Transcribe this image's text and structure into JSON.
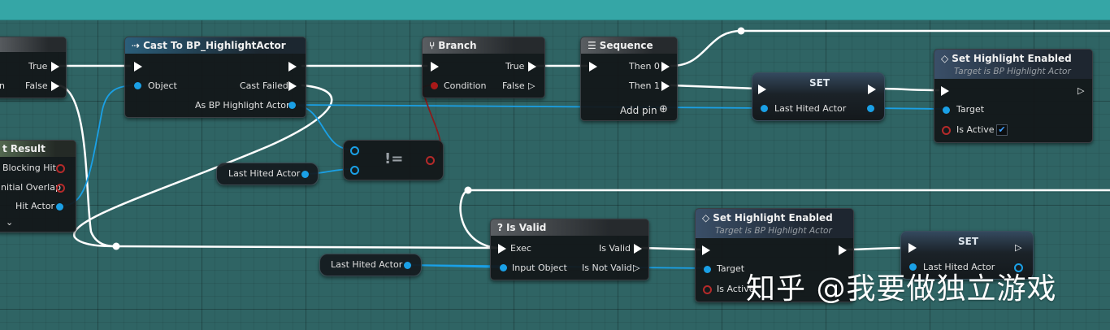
{
  "nodes": {
    "branch_left": {
      "true_label": "True",
      "partial_label": "n",
      "false_label": "False"
    },
    "hit_result": {
      "title": "t Result",
      "pins": [
        "Blocking Hit",
        "nitial Overlap",
        "Hit Actor"
      ]
    },
    "cast": {
      "title": "Cast To BP_HighlightActor",
      "object": "Object",
      "cast_failed": "Cast Failed",
      "as_actor": "As BP Highlight Actor"
    },
    "branch": {
      "title": "Branch",
      "condition": "Condition",
      "true_label": "True",
      "false_label": "False"
    },
    "sequence": {
      "title": "Sequence",
      "then0": "Then 0",
      "then1": "Then 1",
      "add_pin": "Add pin"
    },
    "set_top": {
      "title": "SET",
      "pin": "Last Hited Actor"
    },
    "set_highlight_top": {
      "title": "Set Highlight Enabled",
      "subtitle": "Target is BP Highlight Actor",
      "target": "Target",
      "is_active": "Is Active"
    },
    "not_equal": {
      "symbol": "!="
    },
    "var_mid": {
      "label": "Last Hited Actor"
    },
    "is_valid": {
      "title": "Is Valid",
      "exec": "Exec",
      "is_valid": "Is Valid",
      "input_object": "Input Object",
      "is_not_valid": "Is Not Valid"
    },
    "var_bottom": {
      "label": "Last Hited Actor"
    },
    "set_highlight_bottom": {
      "title": "Set Highlight Enabled",
      "subtitle": "Target is BP Highlight Actor",
      "target": "Target",
      "is_active": "Is Active"
    },
    "set_bottom": {
      "title": "SET",
      "pin": "Last Hited Actor"
    }
  },
  "icons": {
    "cast": "cast-arrow-icon",
    "branch": "branch-icon",
    "sequence": "sequence-icon",
    "function": "function-diamond-icon",
    "is_valid": "question-icon",
    "add_pin": "plus-circle-icon",
    "expand": "chevron-down-icon"
  },
  "colors": {
    "exec": "#ffffff",
    "object_pin": "#1aa0e6",
    "bool_pin": "#a81919",
    "background": "#2f6464",
    "top_band": "#35a6a6"
  },
  "watermark": "知乎 @我要做独立游戏"
}
